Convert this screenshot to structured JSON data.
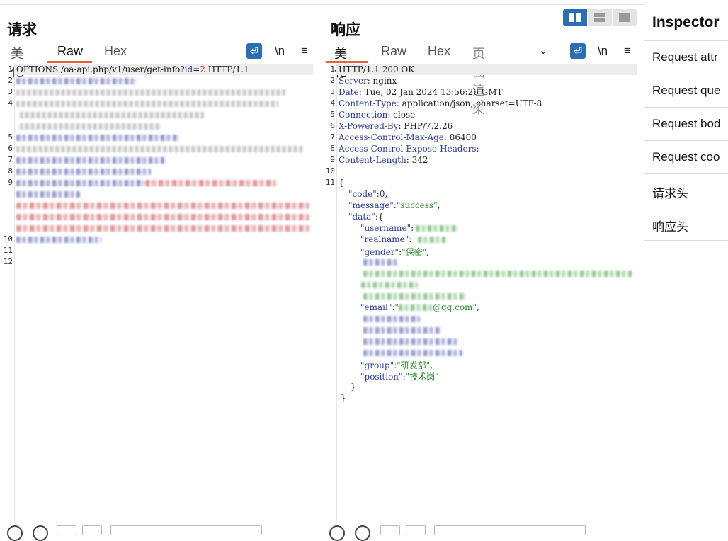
{
  "request": {
    "title": "请求",
    "tabs": [
      "美化",
      "Raw",
      "Hex"
    ],
    "active_tab": "Raw",
    "tools": {
      "wrap": "⏎",
      "newline": "\\n",
      "menu": "≡"
    },
    "line_numbers": [
      "1",
      "2",
      "3",
      "4",
      "5",
      "6",
      "7",
      "8",
      "9",
      "10",
      "11",
      "12"
    ],
    "first_line": {
      "method": "OPTIONS",
      "path": " /oa-api.php/v1/user/get-info?",
      "param_name": "id",
      "eq": "=",
      "param_value": "2",
      "protocol": " HTTP/1.1"
    }
  },
  "response": {
    "title": "响应",
    "tabs": [
      "美化",
      "Raw",
      "Hex",
      "页面渲染"
    ],
    "active_tab": "美化",
    "tools": {
      "wrap": "⏎",
      "newline": "\\n",
      "menu": "≡",
      "more": "⌄"
    },
    "line_numbers": [
      "1",
      "2",
      "3",
      "4",
      "5",
      "6",
      "7",
      "8",
      "9",
      "10",
      "11"
    ],
    "status_line": "HTTP/1.1 200 OK",
    "headers": [
      {
        "name": "Server",
        "value": " nginx"
      },
      {
        "name": "Date",
        "value": " Tue, 02 Jan 2024 13:56:26 GMT"
      },
      {
        "name": "Content-Type",
        "value": " application/json; charset=UTF-8"
      },
      {
        "name": "Connection",
        "value": " close"
      },
      {
        "name": "X-Powered-By",
        "value": " PHP/7.2.26"
      },
      {
        "name": "Access-Control-Max-Age",
        "value": " 86400"
      },
      {
        "name": "Access-Control-Expose-Headers",
        "value": ""
      },
      {
        "name": "Content-Length",
        "value": " 342"
      }
    ],
    "body": {
      "open": "{",
      "code_key": "\"code\"",
      "code_val": "0",
      "message_key": "\"message\"",
      "message_val": "\"success\"",
      "data_key": "\"data\"",
      "data_open": "{",
      "username_key": "\"username\"",
      "realname_key": "\"realname\"",
      "gender_key": "\"gender\"",
      "gender_val": "\"保密\"",
      "email_key": "\"email\"",
      "email_val": "@qq.com\"",
      "group_key": "\"group\"",
      "group_val": "\"研发部\"",
      "position_key": "\"position\"",
      "position_val": "\"技术岗\"",
      "data_close": "}",
      "close": "}"
    }
  },
  "inspector": {
    "title": "Inspector",
    "items": [
      "Request attr",
      "Request que",
      "Request bod",
      "Request coo",
      "请求头",
      "响应头"
    ]
  },
  "colors": {
    "accent": "#2a6fb4",
    "tab_underline": "#e8623a",
    "json_key": "#2b3b9a",
    "json_string": "#2c8a2c"
  }
}
